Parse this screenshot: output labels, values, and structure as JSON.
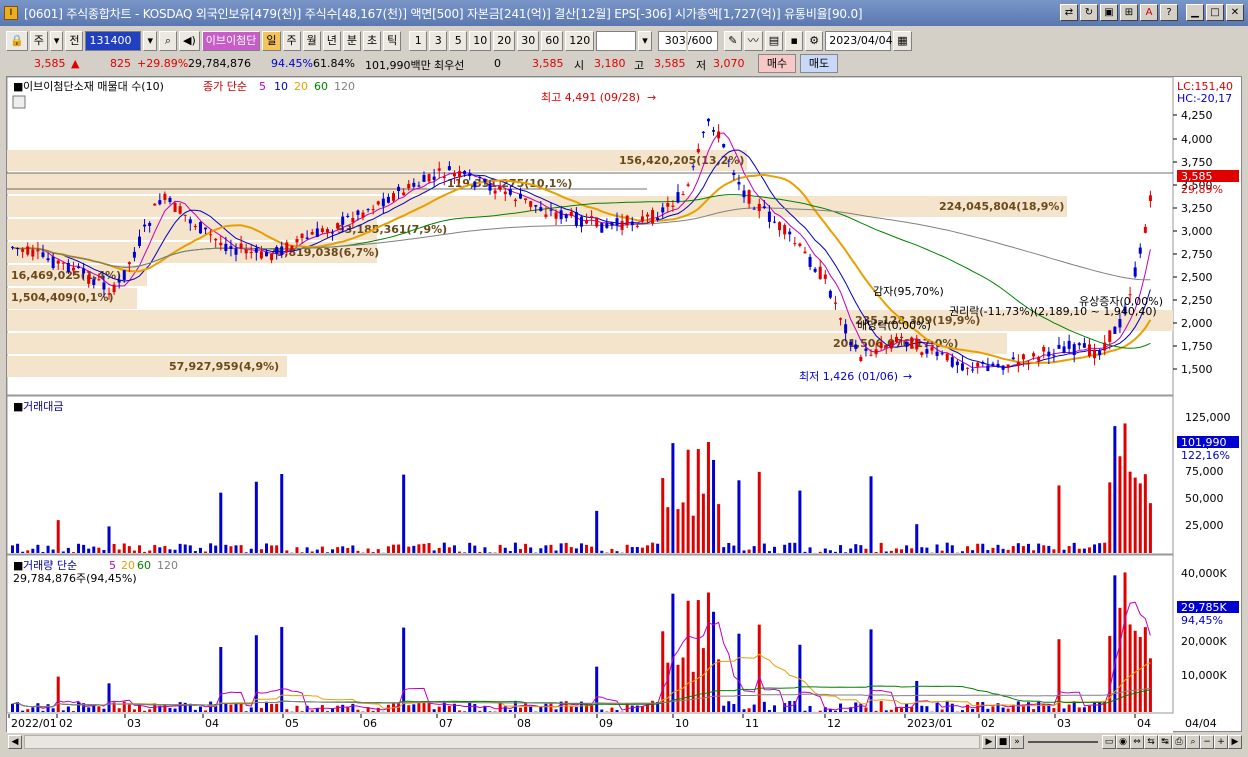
{
  "window": {
    "title": "[0601] 주식종합차트 - KOSDAQ 외국인보유[479(천)] 주식수[48,167(천)] 액면[500] 자본금[241(억)] 결산[12월] EPS[-306] 시가총액[1,727(억)] 유통비율[90.0]",
    "app_icon": "I"
  },
  "toolbar": {
    "type_select": "주",
    "all_button": "전",
    "stock_code": "131400",
    "stock_name": "이브이첨단",
    "periods": [
      "일",
      "주",
      "월",
      "년",
      "분",
      "초",
      "틱"
    ],
    "selected_period": "일",
    "intervals": [
      "1",
      "3",
      "5",
      "10",
      "20",
      "30",
      "60",
      "120"
    ],
    "view_count": "303",
    "max_count": "/600",
    "date": "2023/04/04"
  },
  "quote": {
    "price": "3,585",
    "change": "825",
    "change_pct": "+29.89%",
    "volume": "29,784,876",
    "volume_ratio": "94.45%",
    "turnover": "61.84%",
    "amount": "101,990백만",
    "best_ask_label": "최우선",
    "best_ask_value": "0",
    "best_price": "3,585",
    "open_label": "시",
    "open": "3,180",
    "high_label": "고",
    "high": "3,585",
    "low_label": "저",
    "low": "3,070",
    "buy_button": "매수",
    "sell_button": "매도"
  },
  "legend": {
    "price_title": "이브이첨단소재 매물대 수(10)",
    "ma_label": "종가 단순",
    "ma_periods": [
      "5",
      "10",
      "20",
      "60",
      "120"
    ],
    "amount_title": "거래대금",
    "volume_title": "거래량 단순",
    "volume_ma_periods": [
      "5",
      "20",
      "60",
      "120"
    ],
    "volume_info": "29,784,876주(94,45%)"
  },
  "price_axis": {
    "ticks": [
      "4,250",
      "4,000",
      "3,750",
      "3,500",
      "3,250",
      "3,000",
      "2,750",
      "2,500",
      "2,250",
      "2,000",
      "1,750",
      "1,500"
    ],
    "lc": "LC:151,40",
    "hc": "HC:-20,17",
    "current": "3,585",
    "current_pct": "29,89%"
  },
  "amount_axis": {
    "ticks": [
      "125,000",
      "100,000",
      "75,000",
      "50,000",
      "25,000"
    ],
    "current": "101,990",
    "current_pct": "122,16%"
  },
  "volume_axis": {
    "ticks": [
      "40,000K",
      "30,000K",
      "20,000K",
      "10,000K"
    ],
    "current": "29,785K",
    "current_pct": "94,45%"
  },
  "volume_profile": [
    {
      "label": "156,420,205(13,2%)"
    },
    {
      "label": "119,331,275(10,1%)"
    },
    {
      "label": "224,045,804(18,9%)"
    },
    {
      "label": "93,185,361(7,9%)"
    },
    {
      "label": "75,819,038(6,7%)"
    },
    {
      "label": "16,469,025(1,4%)"
    },
    {
      "label": "1,504,409(0,1%)"
    },
    {
      "label": "235,128,309(19,9%)"
    },
    {
      "label": "201,506,076(17,0%)"
    },
    {
      "label": "57,927,959(4,9%)"
    }
  ],
  "annotations": {
    "high": "최고 4,491 (09/28)",
    "low": "최저 1,426 (01/06)",
    "reduction": "감자(95,70%)",
    "rights": "권리락(-11,73%)(2,189,10 ~ 1,940,40)",
    "dividend": "배당락(0,00%)",
    "paid_increase": "유상증자(0,00%)"
  },
  "x_axis": [
    "2022/01",
    "02",
    "03",
    "04",
    "05",
    "06",
    "07",
    "08",
    "09",
    "10",
    "11",
    "12",
    "2023/01",
    "02",
    "03",
    "04",
    "04/04"
  ],
  "colors": {
    "up": "#e00000",
    "down": "#0000d0",
    "profile": "#f5e4cc",
    "ma5": "#c000c0",
    "ma10": "#0000c0",
    "ma20": "#e8a000",
    "ma60": "#008000",
    "ma120": "#808080"
  }
}
